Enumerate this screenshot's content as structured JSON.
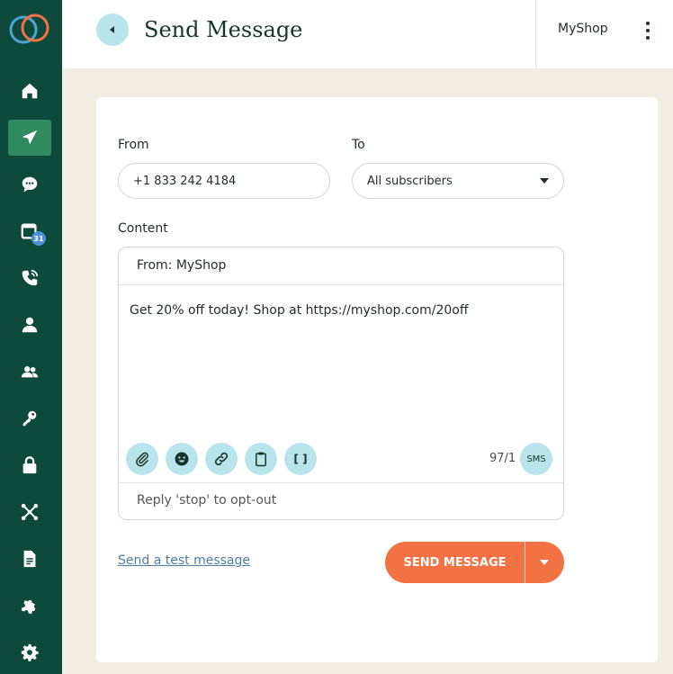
{
  "header": {
    "title": "Send Message",
    "shop_name": "MyShop"
  },
  "sidebar": {
    "badge": "31",
    "items": [
      "home-icon",
      "send-icon",
      "chat-icon",
      "calendar-icon",
      "phone-icon",
      "user-icon",
      "users-icon",
      "key-icon",
      "lock-icon",
      "network-icon",
      "document-icon",
      "puzzle-icon",
      "gear-icon"
    ]
  },
  "form": {
    "from_label": "From",
    "from_value": "+1 833 242 4184",
    "to_label": "To",
    "to_value": "All subscribers",
    "content_label": "Content",
    "compose_from": "From: MyShop",
    "message": "Get 20% off today! Shop at https://myshop.com/20off",
    "char_count": "97/1",
    "channel": "SMS",
    "optout": "Reply 'stop' to opt-out",
    "bracket_tool": "[ ]"
  },
  "actions": {
    "test_link": "Send a test message",
    "send_label": "SEND MESSAGE"
  },
  "colors": {
    "sidebar": "#0d4a3c",
    "sidebar_active": "#2f8a62",
    "accent_light": "#b8e4ec",
    "primary_button": "#f27243",
    "background": "#f1ede4"
  }
}
